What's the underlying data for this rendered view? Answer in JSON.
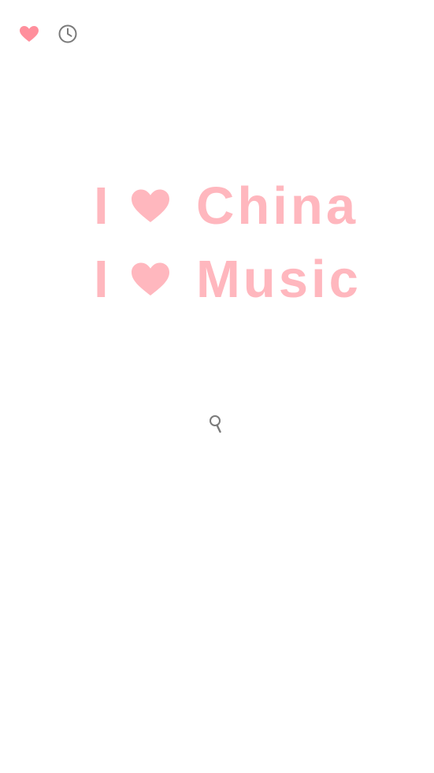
{
  "top_bar": {
    "favorites_icon": "heart-icon",
    "history_icon": "clock-icon"
  },
  "hero": {
    "line1": {
      "letter": "I",
      "icon": "heart-icon",
      "word": "China"
    },
    "line2": {
      "letter": "I",
      "icon": "heart-icon",
      "word": "Music"
    }
  },
  "search": {
    "icon": "search-icon"
  },
  "colors": {
    "background": "#ffffff",
    "accent_pink": "#ffb7be",
    "favorites_heart": "#ff8f9c",
    "icon_gray": "#7a7a7a"
  }
}
